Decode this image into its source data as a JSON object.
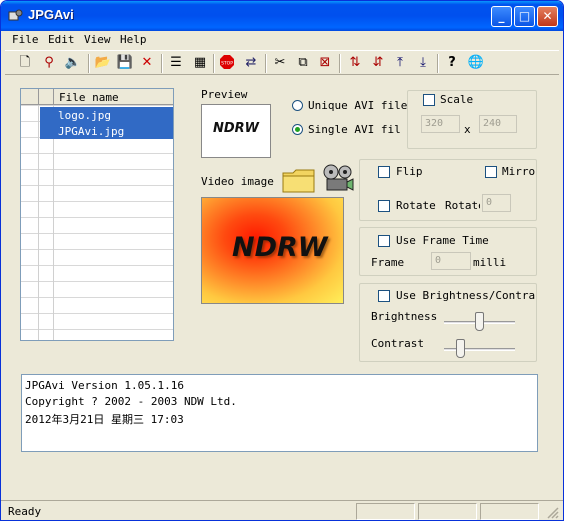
{
  "window": {
    "title": "JPGAvi",
    "buttons": {
      "minimize": "_",
      "maximize": "□",
      "close": "✕"
    }
  },
  "menu": [
    "File",
    "Edit",
    "View",
    "Help"
  ],
  "toolbar_icons": [
    "new-icon",
    "pin-icon",
    "speaker-icon",
    "open-folder-icon",
    "save-icon",
    "delete-icon",
    "stack-icon",
    "film-icon",
    "stop-icon",
    "refresh-icon",
    "cut-icon",
    "copy-icon",
    "remove-icon",
    "sort-asc-icon",
    "sort-desc-icon",
    "move-top-icon",
    "move-bottom-icon",
    "help-icon",
    "web-icon"
  ],
  "filelist": {
    "header": "File name",
    "rows": [
      "logo.jpg",
      "JPGAvi.jpg"
    ]
  },
  "preview": {
    "label": "Preview",
    "logo_text": "NDRW"
  },
  "video": {
    "label": "Video image",
    "logo_text": "NDRW"
  },
  "output": {
    "unique_label": "Unique AVI file",
    "single_label": "Single AVI fil",
    "selected": "single"
  },
  "scale": {
    "label": "Scale",
    "width": "320",
    "x": "x",
    "height": "240"
  },
  "transform": {
    "flip": "Flip",
    "mirror": "Mirror",
    "rotate": "Rotate",
    "rotate_field": "Rotate",
    "rotate_value": "0"
  },
  "frame": {
    "use_label": "Use Frame Time",
    "frame_label": "Frame",
    "value": "0",
    "unit": "milli"
  },
  "brightness": {
    "use_label": "Use Brightness/Contrast",
    "brightness_label": "Brightness",
    "contrast_label": "Contrast",
    "brightness_level": 0.5,
    "contrast_level": 0.2
  },
  "log": [
    "JPGAvi Version   1.05.1.16",
    "Copyright ? 2002 - 2003 NDW Ltd.",
    "2012年3月21日 星期三 17:03"
  ],
  "status": {
    "text": "Ready"
  },
  "colors": {
    "titlebar": "#0053ee",
    "selection": "#316ac5",
    "face": "#ece9d8"
  }
}
